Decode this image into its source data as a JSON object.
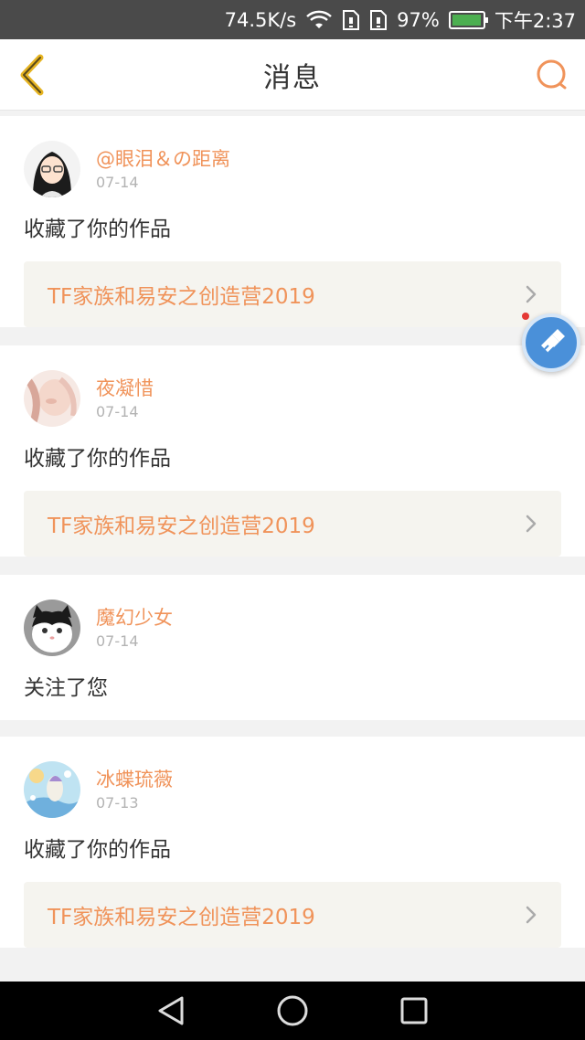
{
  "status_bar": {
    "speed": "74.5K/s",
    "battery": "97%",
    "time": "下午2:37",
    "battery_level": 0.97
  },
  "header": {
    "title": "消息",
    "accent_color": "#f0935a"
  },
  "messages": [
    {
      "username": "@眼泪＆の距离",
      "date": "07-14",
      "action": "收藏了你的作品",
      "work_title": "TF家族和易安之创造营2019"
    },
    {
      "username": "夜凝惜",
      "date": "07-14",
      "action": "收藏了你的作品",
      "work_title": "TF家族和易安之创造营2019"
    },
    {
      "username": "魔幻少女",
      "date": "07-14",
      "action": "关注了您"
    },
    {
      "username": "冰蝶琉薇",
      "date": "07-13",
      "action": "收藏了你的作品",
      "work_title": "TF家族和易安之创造营2019"
    }
  ],
  "icons": {
    "back": "back-chevron-icon",
    "search": "search-icon",
    "chevron": "chevron-right-icon",
    "float_tool": "brush-tool-icon",
    "nav_back": "nav-back-icon",
    "nav_home": "nav-home-icon",
    "nav_recent": "nav-recent-icon"
  }
}
